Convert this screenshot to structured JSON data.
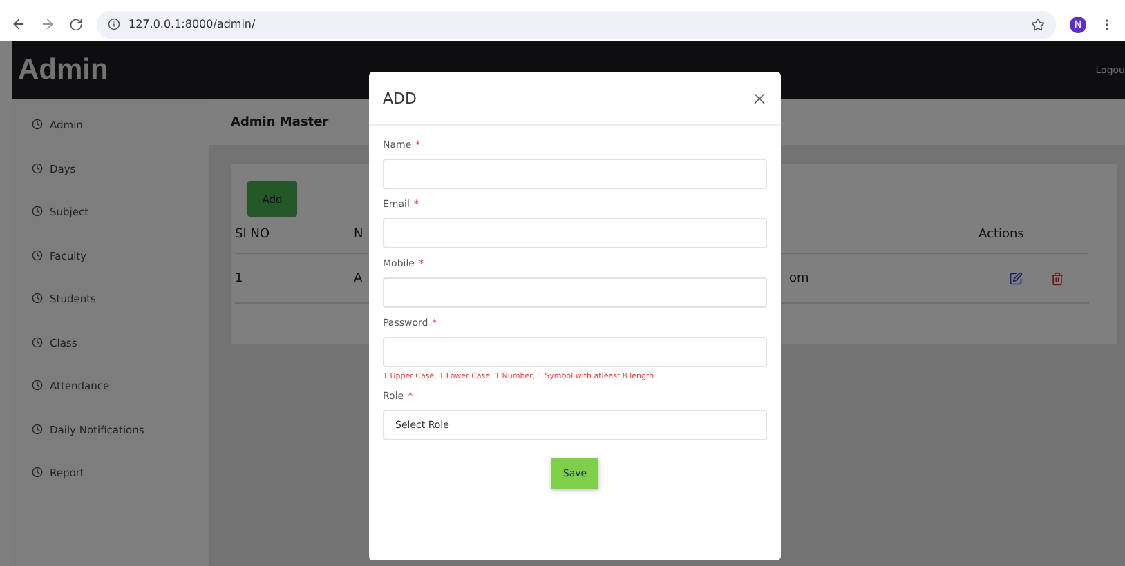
{
  "browser": {
    "url": "127.0.0.1:8000/admin/",
    "profile": "N"
  },
  "app": {
    "brand": "Admin",
    "logout": "Logou"
  },
  "sidebar": {
    "items": [
      {
        "label": "Admin"
      },
      {
        "label": "Days"
      },
      {
        "label": "Subject"
      },
      {
        "label": "Faculty"
      },
      {
        "label": "Students"
      },
      {
        "label": "Class"
      },
      {
        "label": "Attendance"
      },
      {
        "label": "Daily Notifications"
      },
      {
        "label": "Report"
      }
    ]
  },
  "page": {
    "title": "Admin Master",
    "add_button": "Add",
    "table": {
      "columns": [
        "SI NO",
        "N",
        "",
        "Actions"
      ],
      "rows": [
        {
          "cells": [
            "1",
            "A",
            "om"
          ]
        }
      ]
    }
  },
  "modal": {
    "title": "ADD",
    "fields": [
      {
        "kind": "input",
        "label": "Name",
        "required_mark": "*"
      },
      {
        "kind": "input",
        "label": "Email",
        "required_mark": "*"
      },
      {
        "kind": "input",
        "label": "Mobile",
        "required_mark": "*"
      },
      {
        "kind": "input",
        "label": "Password",
        "required_mark": "*",
        "hint": "1 Upper Case, 1 Lower Case, 1 Number, 1 Symbol with atleast 8 length"
      },
      {
        "kind": "select",
        "label": "Role",
        "required_mark": "*",
        "placeholder": "Select Role"
      }
    ],
    "save": "Save"
  }
}
